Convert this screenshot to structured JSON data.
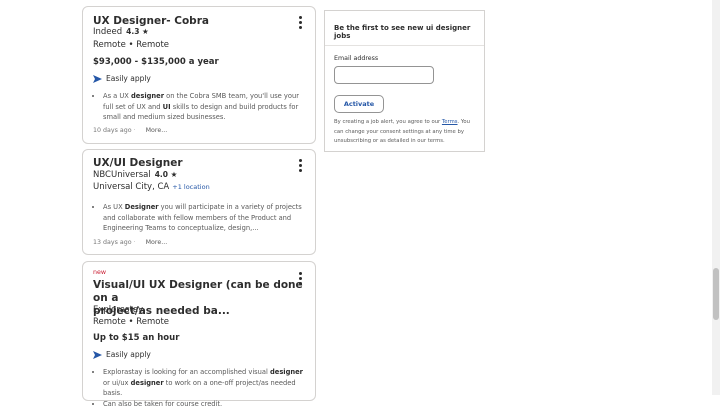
{
  "jobs": [
    {
      "title": "UX Designer- Cobra",
      "company": "Indeed",
      "rating": "4.3 ★",
      "location": "Remote • Remote",
      "salary": "$93,000 - $135,000 a year",
      "easily_apply": "Easily apply",
      "snippet_parts": [
        "As a UX ",
        "designer",
        " on the Cobra SMB team, you'll use your full set of UX and ",
        "UI",
        " skills to design and build products for small and medium sized businesses."
      ],
      "posted": "10 days ago",
      "more": "More..."
    },
    {
      "title": "UX/UI Designer",
      "company": "NBCUniversal",
      "rating": "4.0 ★",
      "location": "Universal City, CA",
      "location_extra": "+1 location",
      "snippet_parts": [
        "As UX ",
        "Designer",
        " you will participate in a variety of projects and collaborate with fellow members of the Product and Engineering Teams to conceptualize, design,..."
      ],
      "posted": "13 days ago",
      "more": "More..."
    },
    {
      "badge": "new",
      "title_line1": "Visual/UI UX Designer (can be done on a",
      "title_line2": "project/as needed ba...",
      "company": "Explorastay",
      "location": "Remote • Remote",
      "salary": "Up to $15 an hour",
      "easily_apply": "Easily apply",
      "snippet_parts": [
        "Explorastay is looking for an accomplished visual ",
        "designer",
        " or ui/ux ",
        "designer",
        " to work on a one-off project/as needed basis."
      ],
      "snippet2": "Can also be taken for course credit."
    }
  ],
  "alert": {
    "heading": "Be the first to see new ui designer jobs",
    "email_label": "Email address",
    "email_value": "",
    "button": "Activate",
    "legal_prefix": "By creating a job alert, you agree to our ",
    "legal_link": "Terms",
    "legal_suffix": ". You can change your consent settings at any time by unsubscribing or as detailed in our terms."
  },
  "colors": {
    "link_blue": "#2557a7",
    "new_red": "#c91d32",
    "border": "#d4d2d0"
  },
  "icons": {
    "menu": "kebab-menu-icon",
    "apply": "send-arrow-icon"
  }
}
